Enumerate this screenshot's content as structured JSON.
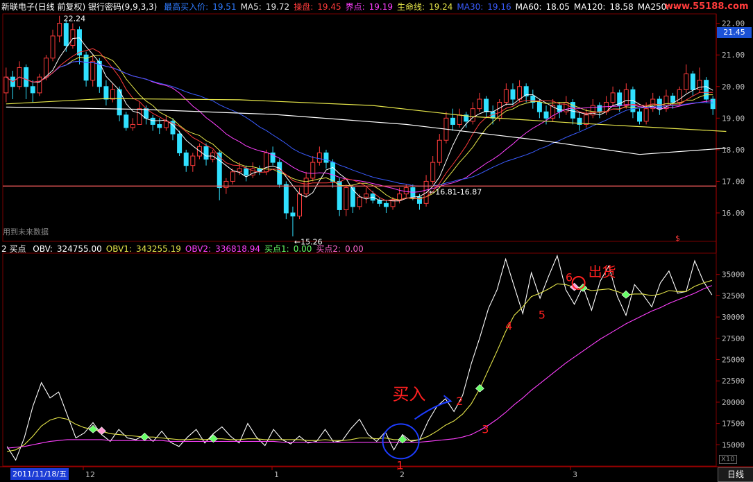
{
  "header_top": {
    "title": "新联电子(日线 前复权) 银行密码(9,9,3,3)",
    "items": [
      {
        "label": "最高买入价:",
        "value": "19.51",
        "color": "#2f7bff"
      },
      {
        "label": "MA5:",
        "value": "19.72",
        "color": "#e7e7e7"
      },
      {
        "label": "操盘:",
        "value": "19.45",
        "color": "#ff3b3b"
      },
      {
        "label": "界点:",
        "value": "19.19",
        "color": "#ff40ff"
      },
      {
        "label": "生命线:",
        "value": "19.24",
        "color": "#e6e64a"
      },
      {
        "label": "MA30:",
        "value": "19.16",
        "color": "#3a5cff"
      },
      {
        "label": "MA60:",
        "value": "18.05",
        "color": "#ffffff"
      },
      {
        "label": "MA120:",
        "value": "18.58",
        "color": "#ffffff"
      },
      {
        "label": "MA250:",
        "value": "-",
        "color": "#ffffff"
      }
    ]
  },
  "watermark": "www.55188.com",
  "header_bottom": {
    "title": "2 买点",
    "items": [
      {
        "label": "OBV:",
        "value": "324755.00",
        "color": "#ffffff"
      },
      {
        "label": "OBV1:",
        "value": "343255.19",
        "color": "#e6e64a"
      },
      {
        "label": "OBV2:",
        "value": "336818.94",
        "color": "#ff40ff"
      },
      {
        "label": "买点1:",
        "value": "0.00",
        "color": "#66ff66"
      },
      {
        "label": "买点2:",
        "value": "0.00",
        "color": "#ff66cc"
      }
    ]
  },
  "futuredata_note": "用到未来数据",
  "price_tag": "21.45",
  "status_tab": "日线",
  "date_box": "2011/11/18/五",
  "x10": "X10",
  "chart_data": [
    {
      "type": "candlestick",
      "y_ticks": [
        16.0,
        17.0,
        18.0,
        19.0,
        20.0,
        21.0,
        22.0
      ],
      "ylim": [
        15.1,
        22.3
      ],
      "annotations": {
        "high": "22.24",
        "low": "←15.26",
        "support_level": 16.85,
        "support_label": "←16.81-16.87"
      },
      "candles": [
        [
          19.8,
          20.3,
          20.6,
          19.5
        ],
        [
          20.3,
          20.0,
          20.5,
          19.6
        ],
        [
          20.0,
          20.6,
          20.8,
          19.9
        ],
        [
          20.6,
          20.0,
          20.7,
          19.6
        ],
        [
          20.0,
          19.8,
          20.2,
          19.5
        ],
        [
          19.8,
          20.3,
          20.4,
          19.7
        ],
        [
          20.3,
          20.9,
          21.0,
          20.2
        ],
        [
          20.9,
          21.6,
          21.8,
          20.8
        ],
        [
          21.6,
          22.0,
          22.24,
          21.4
        ],
        [
          22.0,
          21.3,
          22.1,
          21.1
        ],
        [
          21.3,
          21.8,
          22.0,
          21.2
        ],
        [
          21.8,
          21.0,
          21.9,
          20.7
        ],
        [
          21.0,
          20.2,
          21.1,
          20.0
        ],
        [
          20.2,
          20.8,
          21.0,
          20.0
        ],
        [
          20.8,
          20.0,
          20.9,
          19.8
        ],
        [
          20.0,
          19.6,
          20.2,
          19.4
        ],
        [
          19.6,
          19.9,
          20.1,
          19.5
        ],
        [
          19.9,
          19.1,
          20.0,
          18.9
        ],
        [
          19.1,
          18.7,
          19.2,
          18.6
        ],
        [
          18.7,
          18.8,
          19.0,
          18.6
        ],
        [
          18.8,
          19.3,
          19.5,
          18.8
        ],
        [
          19.3,
          19.0,
          19.4,
          18.8
        ],
        [
          19.0,
          18.8,
          19.1,
          18.6
        ],
        [
          18.8,
          18.7,
          19.0,
          18.5
        ],
        [
          18.7,
          18.9,
          19.1,
          18.6
        ],
        [
          18.9,
          18.5,
          19.0,
          18.3
        ],
        [
          18.5,
          17.9,
          18.6,
          17.8
        ],
        [
          17.9,
          17.5,
          18.0,
          17.3
        ],
        [
          17.5,
          17.8,
          17.9,
          17.3
        ],
        [
          17.8,
          18.1,
          18.2,
          17.7
        ],
        [
          18.1,
          17.7,
          18.2,
          17.5
        ],
        [
          17.7,
          17.9,
          18.0,
          17.6
        ],
        [
          17.9,
          16.8,
          18.0,
          16.4
        ],
        [
          16.8,
          17.0,
          17.1,
          16.6
        ],
        [
          17.0,
          17.3,
          17.4,
          16.9
        ],
        [
          17.3,
          17.4,
          17.6,
          17.2
        ],
        [
          17.4,
          17.2,
          17.5,
          17.0
        ],
        [
          17.2,
          17.4,
          17.6,
          17.1
        ],
        [
          17.4,
          17.3,
          17.5,
          17.2
        ],
        [
          17.3,
          17.9,
          18.0,
          17.2
        ],
        [
          17.9,
          17.6,
          18.1,
          17.5
        ],
        [
          17.6,
          16.9,
          17.7,
          16.8
        ],
        [
          16.9,
          16.0,
          17.0,
          15.8
        ],
        [
          16.0,
          15.9,
          16.2,
          15.26
        ],
        [
          15.9,
          16.6,
          16.8,
          15.8
        ],
        [
          16.6,
          17.1,
          17.3,
          16.5
        ],
        [
          17.1,
          17.6,
          17.8,
          17.0
        ],
        [
          17.6,
          17.9,
          18.1,
          17.5
        ],
        [
          17.9,
          17.6,
          18.0,
          17.4
        ],
        [
          17.6,
          17.0,
          17.7,
          16.8
        ],
        [
          17.0,
          16.1,
          17.1,
          15.9
        ],
        [
          16.1,
          16.8,
          16.9,
          15.9
        ],
        [
          16.8,
          16.2,
          16.9,
          16.0
        ],
        [
          16.2,
          16.5,
          16.6,
          16.1
        ],
        [
          16.5,
          16.6,
          16.8,
          16.3
        ],
        [
          16.6,
          16.4,
          16.7,
          16.3
        ],
        [
          16.4,
          16.3,
          16.5,
          16.2
        ],
        [
          16.3,
          16.2,
          16.4,
          16.0
        ],
        [
          16.2,
          16.4,
          16.5,
          16.1
        ],
        [
          16.4,
          16.6,
          16.8,
          16.3
        ],
        [
          16.6,
          16.8,
          16.9,
          16.5
        ],
        [
          16.8,
          16.5,
          16.9,
          16.4
        ],
        [
          16.5,
          16.3,
          16.6,
          16.1
        ],
        [
          16.3,
          17.0,
          17.2,
          16.2
        ],
        [
          17.0,
          17.6,
          17.8,
          16.9
        ],
        [
          17.6,
          18.3,
          18.5,
          17.5
        ],
        [
          18.3,
          19.0,
          19.2,
          18.2
        ],
        [
          19.0,
          18.8,
          19.3,
          18.6
        ],
        [
          18.8,
          19.1,
          19.3,
          18.7
        ],
        [
          19.1,
          18.9,
          19.2,
          18.7
        ],
        [
          18.9,
          19.3,
          19.5,
          18.8
        ],
        [
          19.3,
          19.6,
          19.8,
          19.2
        ],
        [
          19.6,
          19.2,
          19.7,
          19.0
        ],
        [
          19.2,
          19.0,
          19.4,
          18.8
        ],
        [
          19.0,
          19.5,
          19.6,
          18.9
        ],
        [
          19.5,
          19.9,
          20.1,
          19.4
        ],
        [
          19.9,
          19.6,
          20.1,
          19.4
        ],
        [
          19.6,
          20.0,
          20.2,
          19.5
        ],
        [
          20.0,
          19.7,
          20.1,
          19.5
        ],
        [
          19.7,
          19.5,
          19.9,
          19.3
        ],
        [
          19.5,
          19.2,
          19.6,
          19.0
        ],
        [
          19.2,
          19.0,
          19.4,
          18.8
        ],
        [
          19.0,
          19.4,
          19.6,
          18.9
        ],
        [
          19.4,
          19.2,
          19.5,
          19.0
        ],
        [
          19.2,
          19.5,
          19.7,
          19.1
        ],
        [
          19.5,
          19.0,
          19.6,
          18.8
        ],
        [
          19.0,
          18.8,
          19.2,
          18.6
        ],
        [
          18.8,
          19.1,
          19.3,
          18.7
        ],
        [
          19.1,
          19.4,
          19.6,
          19.0
        ],
        [
          19.4,
          19.2,
          19.5,
          19.0
        ],
        [
          19.2,
          19.5,
          19.7,
          19.1
        ],
        [
          19.5,
          19.8,
          20.0,
          19.4
        ],
        [
          19.8,
          19.4,
          19.9,
          19.2
        ],
        [
          19.4,
          19.9,
          20.1,
          19.3
        ],
        [
          19.9,
          19.2,
          20.0,
          19.0
        ],
        [
          19.2,
          18.9,
          19.3,
          18.8
        ],
        [
          18.9,
          19.3,
          19.5,
          18.8
        ],
        [
          19.3,
          19.6,
          19.8,
          19.2
        ],
        [
          19.6,
          19.3,
          19.7,
          19.1
        ],
        [
          19.3,
          19.7,
          19.9,
          19.2
        ],
        [
          19.7,
          19.5,
          19.8,
          19.3
        ],
        [
          19.5,
          19.9,
          20.0,
          19.4
        ],
        [
          19.9,
          20.4,
          20.7,
          19.8
        ],
        [
          20.4,
          19.9,
          20.5,
          19.7
        ],
        [
          19.9,
          20.2,
          20.6,
          19.8
        ],
        [
          20.2,
          19.6,
          20.3,
          19.5
        ],
        [
          19.6,
          19.3,
          19.7,
          19.1
        ]
      ],
      "lines": [
        {
          "name": "MA5",
          "color": "#ffffff",
          "window": 5
        },
        {
          "name": "MA10",
          "color": "#e6e64a",
          "window": 10
        },
        {
          "name": "MA20",
          "color": "#ff40ff",
          "window": 20
        },
        {
          "name": "MA30",
          "color": "#3a5cff",
          "window": 30
        },
        {
          "name": "操盘",
          "color": "#ff3b3b",
          "window": 8
        }
      ],
      "long_lines": [
        {
          "name": "MA60",
          "color": "#ffffff",
          "points": [
            [
              0,
              19.35
            ],
            [
              20,
              19.28
            ],
            [
              40,
              19.12
            ],
            [
              60,
              18.8
            ],
            [
              80,
              18.3
            ],
            [
              95,
              17.85
            ],
            [
              108,
              18.05
            ]
          ]
        },
        {
          "name": "MA120",
          "color": "#e6e64a",
          "points": [
            [
              0,
              19.45
            ],
            [
              15,
              19.62
            ],
            [
              35,
              19.58
            ],
            [
              55,
              19.4
            ],
            [
              70,
              19.05
            ],
            [
              85,
              18.85
            ],
            [
              108,
              18.58
            ]
          ]
        }
      ]
    },
    {
      "type": "line",
      "y_ticks": [
        15000,
        17500,
        20000,
        22500,
        25000,
        27500,
        30000,
        32500,
        35000
      ],
      "ylim": [
        12500,
        37500
      ],
      "series": [
        {
          "name": "OBV",
          "color": "#ffffff",
          "values": [
            14800,
            13200,
            15800,
            19500,
            22300,
            20500,
            21200,
            18500,
            15800,
            16400,
            17600,
            16200,
            15400,
            16800,
            15800,
            15600,
            16200,
            15400,
            16600,
            15300,
            14800,
            15900,
            16800,
            15200,
            16300,
            17100,
            16000,
            15200,
            17500,
            15900,
            14900,
            16800,
            15600,
            15100,
            16000,
            15200,
            15400,
            16800,
            15300,
            15500,
            16900,
            18000,
            16200,
            15400,
            16500,
            14400,
            16200,
            15400,
            15600,
            17800,
            19500,
            20400,
            18900,
            20800,
            24500,
            27600,
            31000,
            33200,
            36800,
            33600,
            30400,
            35200,
            32200,
            34800,
            37200,
            33200,
            31500,
            33600,
            30800,
            34200,
            36000,
            32400,
            30200,
            33800,
            32600,
            31200,
            34000,
            35400,
            32800,
            33000,
            36600,
            34200,
            32600
          ]
        },
        {
          "name": "OBV1",
          "color": "#e6e64a",
          "values": [
            14200,
            14400,
            15000,
            16000,
            17200,
            17900,
            18200,
            18000,
            17400,
            17000,
            16800,
            16600,
            16300,
            16200,
            16100,
            16000,
            15900,
            15900,
            15800,
            15700,
            15600,
            15600,
            15700,
            15600,
            15700,
            15700,
            15600,
            15600,
            15700,
            15700,
            15600,
            15600,
            15600,
            15600,
            15600,
            15500,
            15500,
            15600,
            15500,
            15500,
            15600,
            15800,
            15800,
            15700,
            15800,
            15600,
            15600,
            15500,
            15600,
            16000,
            16600,
            17300,
            17800,
            18600,
            19800,
            21600,
            23800,
            26000,
            28300,
            30200,
            31200,
            32400,
            32800,
            33300,
            33900,
            33800,
            33500,
            33400,
            33100,
            33200,
            33300,
            33000,
            32600,
            32700,
            32700,
            32500,
            32700,
            33100,
            33000,
            33000,
            33600,
            34000,
            34300
          ]
        },
        {
          "name": "OBV2",
          "color": "#ff40ff",
          "values": [
            14600,
            14700,
            14800,
            15000,
            15200,
            15400,
            15500,
            15600,
            15600,
            15600,
            15600,
            15600,
            15500,
            15500,
            15500,
            15500,
            15500,
            15500,
            15500,
            15400,
            15400,
            15400,
            15400,
            15400,
            15400,
            15400,
            15400,
            15400,
            15400,
            15400,
            15400,
            15400,
            15300,
            15300,
            15300,
            15300,
            15300,
            15300,
            15300,
            15300,
            15300,
            15300,
            15300,
            15300,
            15300,
            15300,
            15300,
            15300,
            15300,
            15400,
            15500,
            15600,
            15700,
            15900,
            16200,
            16700,
            17300,
            18000,
            18800,
            19700,
            20500,
            21400,
            22200,
            23000,
            23800,
            24600,
            25300,
            26000,
            26700,
            27400,
            28000,
            28600,
            29200,
            29700,
            30200,
            30700,
            31100,
            31600,
            32000,
            32400,
            32800,
            33300,
            33700
          ]
        },
        {
          "name": "买点1",
          "color": "#66ff66",
          "markers": [
            10,
            16,
            24,
            46,
            55,
            67,
            72
          ]
        },
        {
          "name": "买点2",
          "color": "#ff9ad5",
          "markers": [
            11,
            66
          ]
        }
      ],
      "handwritten": [
        "买入",
        "出货",
        "1",
        "2",
        "3",
        "4",
        "5",
        "6"
      ]
    }
  ]
}
